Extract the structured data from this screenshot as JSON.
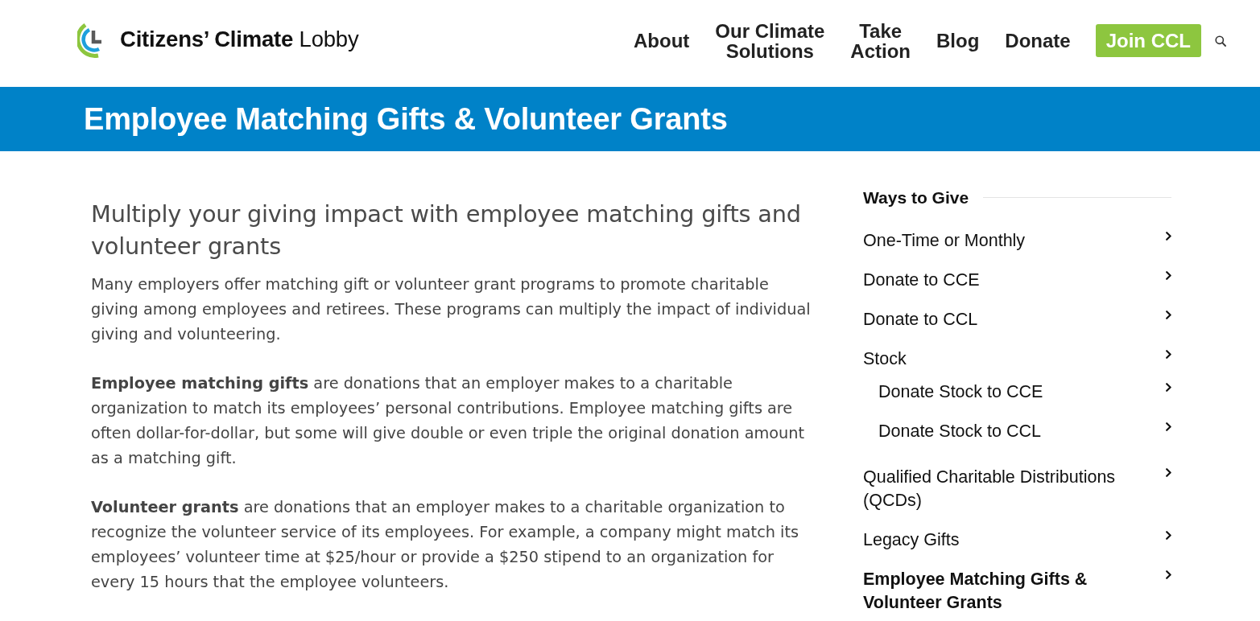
{
  "header": {
    "logo_text": "**Citizens’ Climate** Lobby",
    "nav": [
      {
        "label": "About"
      },
      {
        "label": "Our Climate\nSolutions"
      },
      {
        "label": "Take\nAction"
      },
      {
        "label": "Blog"
      },
      {
        "label": "Donate"
      }
    ],
    "cta_button": "Join CCL"
  },
  "banner": {
    "title": "Employee Matching Gifts & Volunteer Grants"
  },
  "main": {
    "heading": "Multiply your giving impact with employee matching gifts and volunteer grants",
    "paragraphs": [
      "Many employers offer matching gift or volunteer grant programs to promote charitable giving among employees and retirees. These programs can multiply the impact of individual giving and volunteering.",
      "**Employee matching gifts** are donations that an employer makes to a charitable organization to match its employees’ personal contributions. Employee matching gifts are often dollar-for-dollar, but some will give double or even triple the original donation amount as a matching gift.",
      "**Volunteer grants** are donations that an employer makes to a charitable organization to recognize the volunteer service of its employees. For example, a company might match its employees’ volunteer time at $25/hour or provide a $250 stipend to an organization for every 15 hours that the employee volunteers."
    ]
  },
  "sidebar": {
    "title": "Ways to Give",
    "items": [
      {
        "label": "One-Time or Monthly",
        "selected": false
      },
      {
        "label": "Donate to CCE",
        "selected": false
      },
      {
        "label": "Donate to CCL",
        "selected": false
      },
      {
        "label": "Stock",
        "selected": false,
        "children": [
          {
            "label": "Donate Stock to CCE",
            "selected": false
          },
          {
            "label": "Donate Stock to CCL",
            "selected": false
          }
        ]
      },
      {
        "label": "Qualified Charitable Distributions (QCDs)",
        "selected": false
      },
      {
        "label": "Legacy Gifts",
        "selected": false
      },
      {
        "label": "Employee Matching Gifts & Volunteer Grants",
        "selected": true
      }
    ]
  }
}
